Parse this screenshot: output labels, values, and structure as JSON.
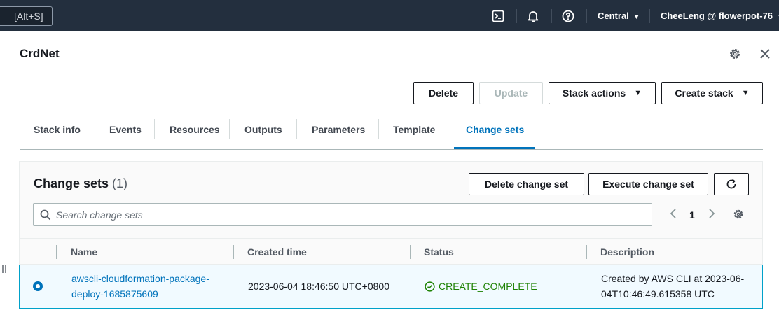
{
  "topnav": {
    "shortcut_hint": "[Alt+S]",
    "region": "Central",
    "account": "CheeLeng @ flowerpot-76",
    "icons": [
      "cloudshell-icon",
      "notifications-icon",
      "help-icon"
    ]
  },
  "header": {
    "title": "CrdNet"
  },
  "actions": {
    "delete": "Delete",
    "update": "Update",
    "stack_actions": "Stack actions",
    "create_stack": "Create stack"
  },
  "tabs": [
    {
      "label": "Stack info"
    },
    {
      "label": "Events"
    },
    {
      "label": "Resources"
    },
    {
      "label": "Outputs"
    },
    {
      "label": "Parameters"
    },
    {
      "label": "Template"
    },
    {
      "label": "Change sets",
      "active": true
    }
  ],
  "change_sets": {
    "title": "Change sets",
    "count": "(1)",
    "delete_button": "Delete change set",
    "execute_button": "Execute change set",
    "search_placeholder": "Search change sets",
    "page": "1",
    "columns": [
      "Name",
      "Created time",
      "Status",
      "Description"
    ],
    "rows": [
      {
        "selected": true,
        "name_line1": "awscli-cloudformation-package-",
        "name_line2": "deploy-1685875609",
        "created": "2023-06-04 18:46:50 UTC+0800",
        "status": "CREATE_COMPLETE",
        "description_line1": "Created by AWS CLI at 2023-06-",
        "description_line2": "04T10:46:49.615358 UTC"
      }
    ]
  },
  "colors": {
    "nav_bg": "#232f3e",
    "link": "#0073bb",
    "success": "#1d8102",
    "selected_row_bg": "#f1faff",
    "selected_row_border": "#00a1c9"
  }
}
